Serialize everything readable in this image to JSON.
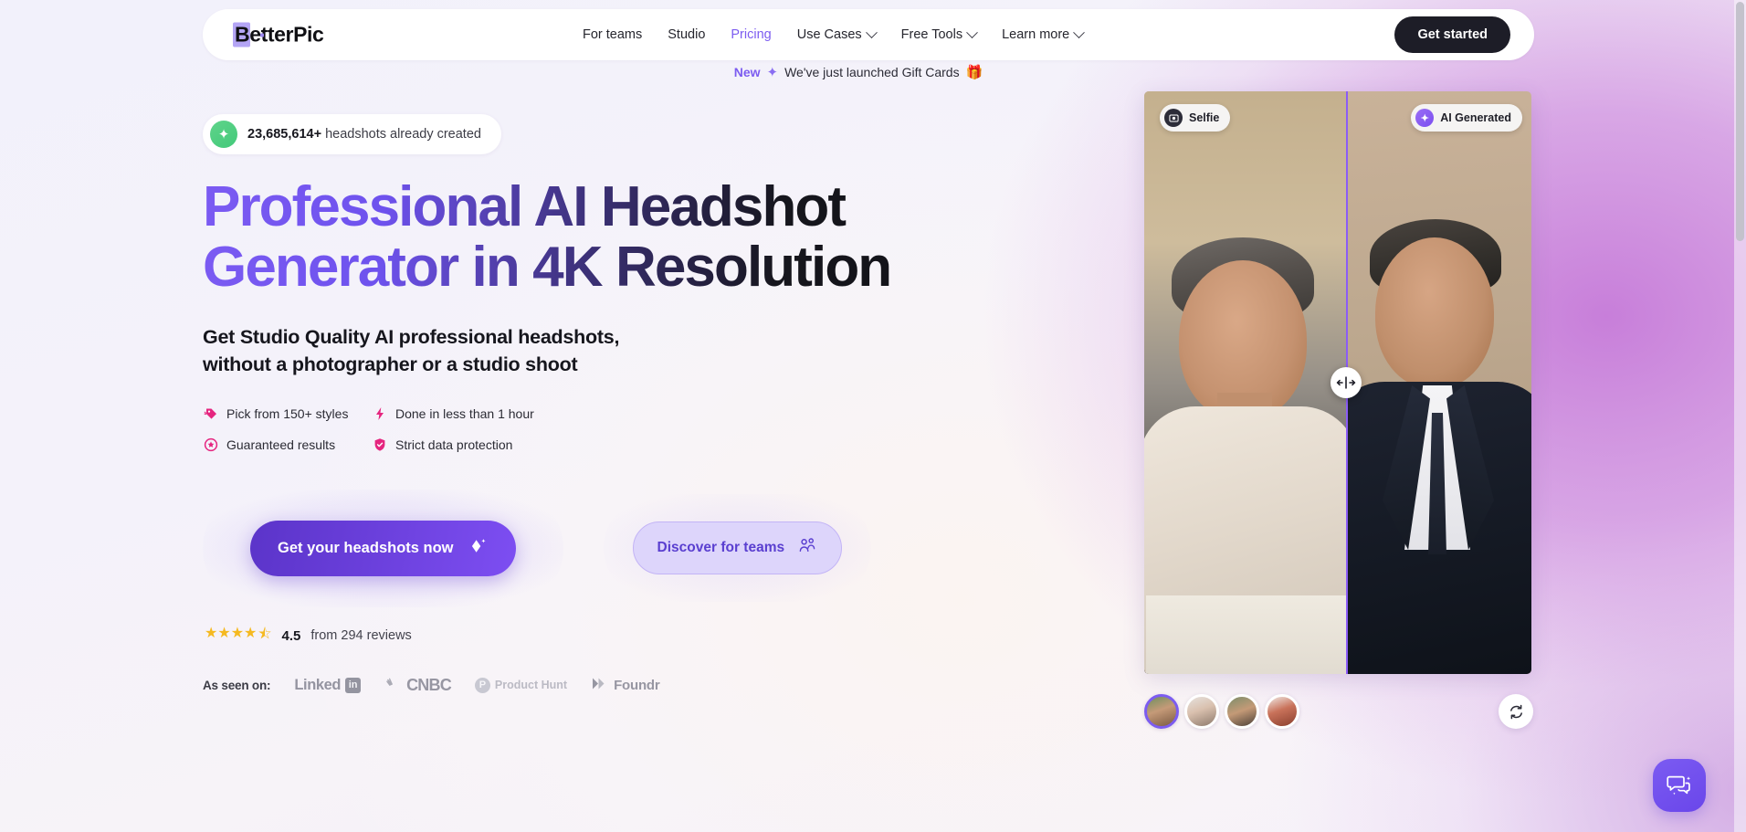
{
  "brand": {
    "name_highlight": "B",
    "name_rest": "etterPic"
  },
  "nav": {
    "items": [
      {
        "label": "For teams",
        "has_chevron": false,
        "active": false
      },
      {
        "label": "Studio",
        "has_chevron": false,
        "active": false
      },
      {
        "label": "Pricing",
        "has_chevron": false,
        "active": true
      },
      {
        "label": "Use Cases",
        "has_chevron": true,
        "active": false
      },
      {
        "label": "Free Tools",
        "has_chevron": true,
        "active": false
      },
      {
        "label": "Learn more",
        "has_chevron": true,
        "active": false
      }
    ],
    "cta_label": "Get started"
  },
  "announcement": {
    "tag": "New",
    "sparkle": "✦",
    "text": "We've just launched Gift Cards",
    "emoji": "🎁"
  },
  "counter": {
    "icon": "sparkle-icon",
    "glyph": "✦",
    "number": "23,685,614+",
    "suffix": " headshots already created"
  },
  "hero": {
    "headline_line1": "Professional AI Headshot",
    "headline_line2": "Generator in 4K Resolution",
    "subhead_line1": "Get Studio Quality AI professional headshots,",
    "subhead_line2": "without a photographer or a studio shoot"
  },
  "features": [
    {
      "icon": "tag-icon",
      "glyph": "🏷",
      "label": "Pick from 150+ styles"
    },
    {
      "icon": "lightning-icon",
      "glyph": "⚡",
      "label": "Done in less than 1 hour"
    },
    {
      "icon": "star-badge-icon",
      "glyph": "⭑",
      "label": "Guaranteed results"
    },
    {
      "icon": "shield-icon",
      "glyph": "▼",
      "label": "Strict data protection"
    }
  ],
  "cta": {
    "primary_label": "Get your headshots now",
    "primary_icon": "diamond-sparkle-icon",
    "secondary_label": "Discover for teams",
    "secondary_icon": "people-icon"
  },
  "rating": {
    "stars_display": "★★★★",
    "half_star": "⯪",
    "score": "4.5",
    "reviews_text": "from 294 reviews"
  },
  "as_seen_on": {
    "label": "As seen on:",
    "brands": [
      {
        "name": "LinkedIn",
        "text": "Linked",
        "mark": "in"
      },
      {
        "name": "CNBC",
        "text": "CNBC"
      },
      {
        "name": "Product Hunt",
        "text": "Product Hunt",
        "mark": "P"
      },
      {
        "name": "Foundr",
        "text": "Foundr",
        "mark": "❯❯"
      }
    ]
  },
  "compare": {
    "left_badge": {
      "label": "Selfie",
      "icon": "camera-icon",
      "glyph": "📷"
    },
    "right_badge": {
      "label": "AI Generated",
      "icon": "ai-sparkle-icon",
      "glyph": "✦"
    },
    "handle_icon": "drag-horizontal-icon",
    "handle_glyph": "↔",
    "refresh_icon": "refresh-icon",
    "refresh_glyph": "↻"
  },
  "avatars": [
    {
      "name": "avatar-1",
      "active": true
    },
    {
      "name": "avatar-2",
      "active": false
    },
    {
      "name": "avatar-3",
      "active": false
    },
    {
      "name": "avatar-4",
      "active": false
    }
  ],
  "chat": {
    "icon": "chat-bubble-icon",
    "glyph": "💬"
  },
  "colors": {
    "accent_purple": "#7c5cf0",
    "cta_purple_start": "#5b34c9",
    "cta_purple_end": "#7d4ef2",
    "dark": "#1d1d27",
    "green": "#43c97a",
    "pink": "#e5257f",
    "star_yellow": "#f5b921"
  }
}
